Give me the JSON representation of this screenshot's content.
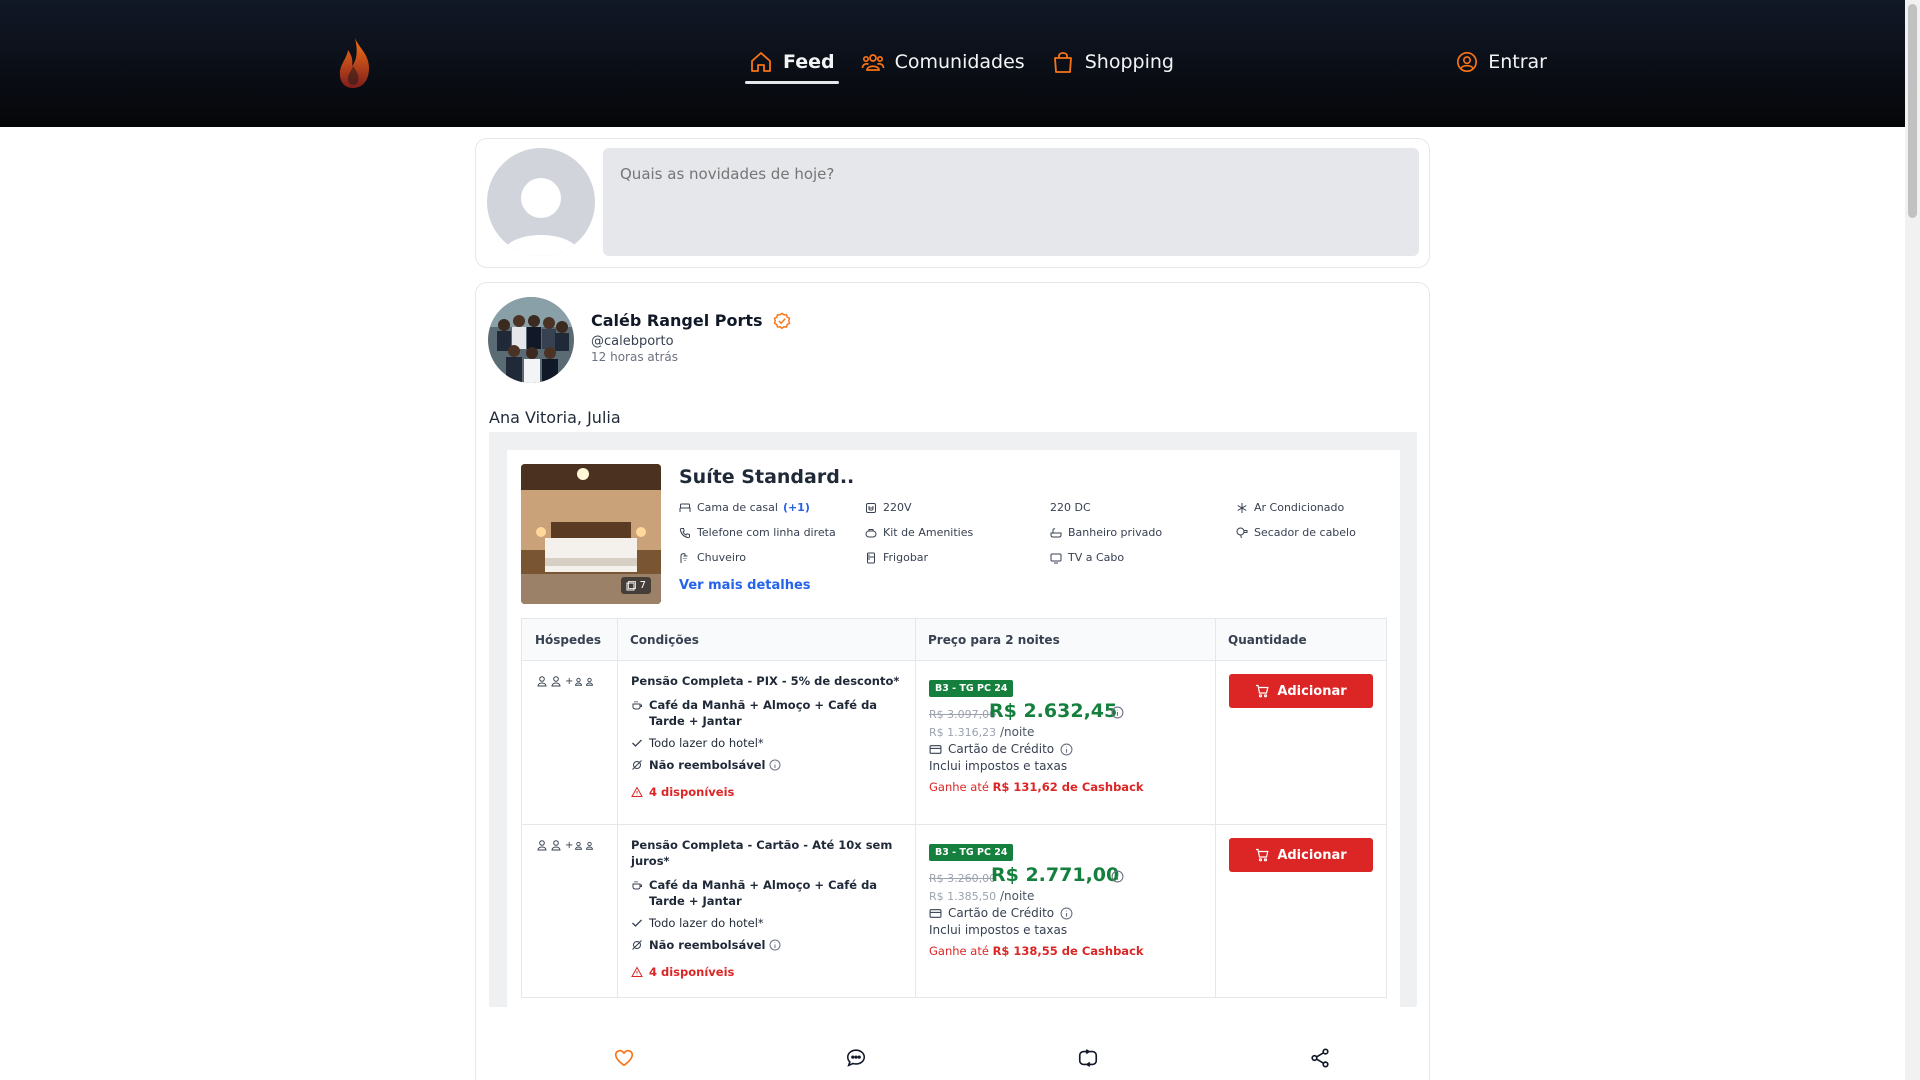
{
  "nav": {
    "items": [
      {
        "label": "Feed",
        "icon": "home-icon",
        "active": true
      },
      {
        "label": "Comunidades",
        "icon": "users-icon",
        "active": false
      },
      {
        "label": "Shopping",
        "icon": "shopping-bag-icon",
        "active": false
      }
    ],
    "login_label": "Entrar",
    "accent": "#f97316"
  },
  "composer": {
    "placeholder": "Quais as novidades de hoje?"
  },
  "post": {
    "author_name": "Caléb Rangel Ports",
    "author_handle": "@calebporto",
    "time_ago": "12 horas atrás",
    "text": "Ana Vitoria, Julia",
    "room": {
      "title": "Suíte Standard..",
      "photo_count": "7",
      "amenities": [
        {
          "label": "Cama de casal",
          "extra": "(+1)",
          "icon": "bed-icon"
        },
        {
          "label": "220V",
          "icon": "plug-icon"
        },
        {
          "label": "220 DC",
          "icon": ""
        },
        {
          "label": "Ar Condicionado",
          "icon": "snowflake-icon"
        },
        {
          "label": "Telefone com linha direta",
          "icon": "phone-icon"
        },
        {
          "label": "Kit de Amenities",
          "icon": "amenities-icon"
        },
        {
          "label": "Banheiro privado",
          "icon": "bath-icon"
        },
        {
          "label": "Secador de cabelo",
          "icon": "hairdryer-icon"
        },
        {
          "label": "Chuveiro",
          "icon": "shower-icon"
        },
        {
          "label": "Frigobar",
          "icon": "fridge-icon"
        },
        {
          "label": "TV a Cabo",
          "icon": "tv-icon"
        }
      ],
      "more_details": "Ver mais detalhes",
      "table_headers": {
        "guests": "Hóspedes",
        "conditions": "Condições",
        "price": "Preço para 2 noites",
        "quantity": "Quantidade"
      },
      "rates": [
        {
          "title": "Pensão Completa - PIX - 5% de desconto*",
          "meals": "Café da Manhã + Almoço + Café da Tarde + Jantar",
          "leisure": "Todo lazer do hotel*",
          "refund": "Não reembolsável",
          "availability": "4 disponíveis",
          "badge": "B3 - TG PC 24",
          "old_price": "R$ 3.097,00",
          "price": "R$ 2.632,45",
          "per_night_value": "R$ 1.316,23",
          "per_night_label": "/noite",
          "payment": "Cartão de Crédito",
          "taxes": "Inclui impostos e taxas",
          "cashback_prefix": "Ganhe até",
          "cashback_value": "R$ 131,62 de Cashback",
          "button": "Adicionar"
        },
        {
          "title": "Pensão Completa - Cartão - Até 10x sem juros*",
          "meals": "Café da Manhã + Almoço + Café da Tarde + Jantar",
          "leisure": "Todo lazer do hotel*",
          "refund": "Não reembolsável",
          "availability": "4 disponíveis",
          "badge": "B3 - TG PC 24",
          "old_price": "R$ 3.260,00",
          "price": "R$ 2.771,00",
          "per_night_value": "R$ 1.385,50",
          "per_night_label": "/noite",
          "payment": "Cartão de Crédito",
          "taxes": "Inclui impostos e taxas",
          "cashback_prefix": "Ganhe até",
          "cashback_value": "R$ 138,55 de Cashback",
          "button": "Adicionar"
        }
      ]
    },
    "actions": [
      {
        "icon": "heart-icon"
      },
      {
        "icon": "comment-icon"
      },
      {
        "icon": "repost-icon"
      },
      {
        "icon": "share-icon"
      }
    ]
  },
  "colors": {
    "header_bg": "#0b0e14",
    "price_green": "#15803d",
    "cta_red": "#dc2626",
    "link_blue": "#2563eb"
  }
}
